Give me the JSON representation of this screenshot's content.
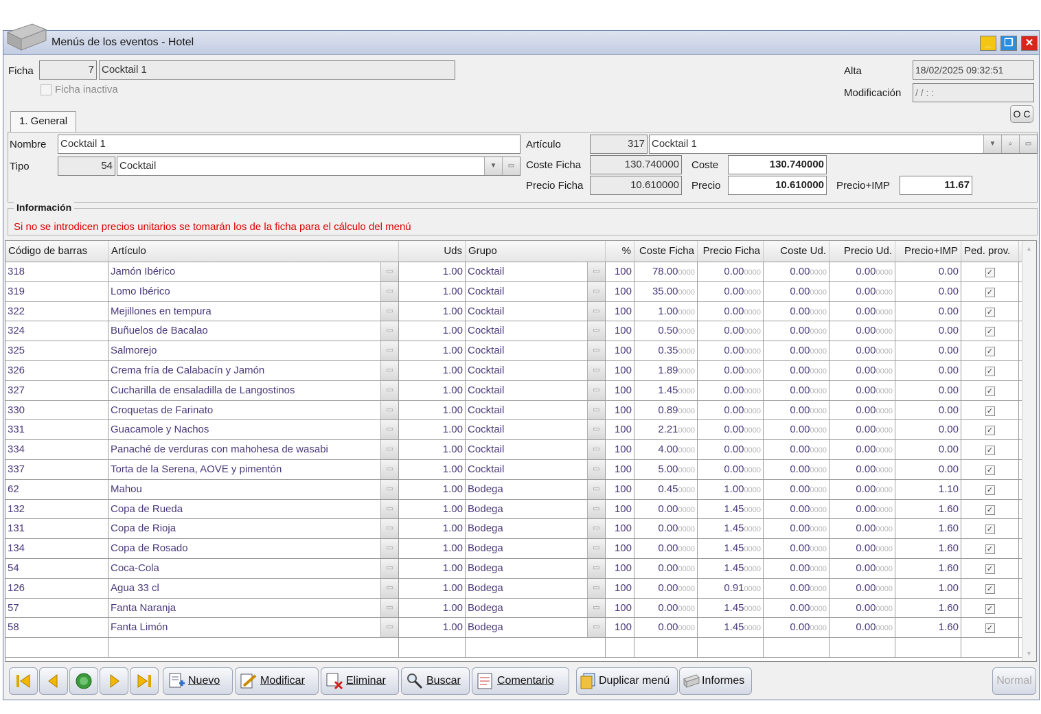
{
  "window": {
    "title": "Menús de los eventos - Hotel",
    "buttons": {
      "minimize": "_",
      "restore": "❐",
      "close": "✕"
    }
  },
  "header": {
    "ficha_label": "Ficha",
    "ficha_id": "7",
    "ficha_name": "Cocktail 1",
    "inactive_label": "Ficha inactiva",
    "inactive_checked": false,
    "alta_label": "Alta",
    "alta_value": "18/02/2025  09:32:51",
    "mod_label": "Modificación",
    "mod_value": " /  /           :   :",
    "oc_label": "O C"
  },
  "tabs": [
    {
      "label": "1. General"
    }
  ],
  "general": {
    "nombre_label": "Nombre",
    "nombre_value": "Cocktail 1",
    "tipo_label": "Tipo",
    "tipo_code": "54",
    "tipo_value": "Cocktail",
    "articulo_label": "Artículo",
    "articulo_code": "317",
    "articulo_value": "Cocktail 1",
    "coste_ficha_label": "Coste Ficha",
    "coste_ficha_value": "130.740000",
    "coste_label": "Coste",
    "coste_value": "130.740000",
    "precio_ficha_label": "Precio Ficha",
    "precio_ficha_value": "10.610000",
    "precio_label": "Precio",
    "precio_value": "10.610000",
    "precio_imp_label": "Precio+IMP",
    "precio_imp_value": "11.67"
  },
  "info": {
    "title": "Información",
    "message": "Si no se introdicen precios unitarios se tomarán los de la ficha para el cálculo del menú"
  },
  "table": {
    "columns": [
      "Código de barras",
      "Artículo",
      "Uds",
      "Grupo",
      "%",
      "Coste Ficha",
      "Precio Ficha",
      "Coste Ud.",
      "Precio Ud.",
      "Precio+IMP",
      "Ped. prov."
    ],
    "decimal_suffix": "0000",
    "rows": [
      {
        "code": "318",
        "articulo": "Jamón Ibérico",
        "uds": "1.00",
        "grupo": "Cocktail",
        "pct": "100",
        "coste_ficha": "78.00",
        "precio_ficha": "0.00",
        "coste_ud": "0.00",
        "precio_ud": "0.00",
        "precio_imp": "0.00",
        "ped_prov": true
      },
      {
        "code": "319",
        "articulo": "Lomo Ibérico",
        "uds": "1.00",
        "grupo": "Cocktail",
        "pct": "100",
        "coste_ficha": "35.00",
        "precio_ficha": "0.00",
        "coste_ud": "0.00",
        "precio_ud": "0.00",
        "precio_imp": "0.00",
        "ped_prov": true
      },
      {
        "code": "322",
        "articulo": "Mejillones en tempura",
        "uds": "1.00",
        "grupo": "Cocktail",
        "pct": "100",
        "coste_ficha": "1.00",
        "precio_ficha": "0.00",
        "coste_ud": "0.00",
        "precio_ud": "0.00",
        "precio_imp": "0.00",
        "ped_prov": true
      },
      {
        "code": "324",
        "articulo": "Buñuelos de Bacalao",
        "uds": "1.00",
        "grupo": "Cocktail",
        "pct": "100",
        "coste_ficha": "0.50",
        "precio_ficha": "0.00",
        "coste_ud": "0.00",
        "precio_ud": "0.00",
        "precio_imp": "0.00",
        "ped_prov": true
      },
      {
        "code": "325",
        "articulo": "Salmorejo",
        "uds": "1.00",
        "grupo": "Cocktail",
        "pct": "100",
        "coste_ficha": "0.35",
        "precio_ficha": "0.00",
        "coste_ud": "0.00",
        "precio_ud": "0.00",
        "precio_imp": "0.00",
        "ped_prov": true
      },
      {
        "code": "326",
        "articulo": "Crema fría de Calabacín y Jamón",
        "uds": "1.00",
        "grupo": "Cocktail",
        "pct": "100",
        "coste_ficha": "1.89",
        "precio_ficha": "0.00",
        "coste_ud": "0.00",
        "precio_ud": "0.00",
        "precio_imp": "0.00",
        "ped_prov": true
      },
      {
        "code": "327",
        "articulo": "Cucharilla de ensaladilla de Langostinos",
        "uds": "1.00",
        "grupo": "Cocktail",
        "pct": "100",
        "coste_ficha": "1.45",
        "precio_ficha": "0.00",
        "coste_ud": "0.00",
        "precio_ud": "0.00",
        "precio_imp": "0.00",
        "ped_prov": true
      },
      {
        "code": "330",
        "articulo": "Croquetas de Farinato",
        "uds": "1.00",
        "grupo": "Cocktail",
        "pct": "100",
        "coste_ficha": "0.89",
        "precio_ficha": "0.00",
        "coste_ud": "0.00",
        "precio_ud": "0.00",
        "precio_imp": "0.00",
        "ped_prov": true
      },
      {
        "code": "331",
        "articulo": "Guacamole y Nachos",
        "uds": "1.00",
        "grupo": "Cocktail",
        "pct": "100",
        "coste_ficha": "2.21",
        "precio_ficha": "0.00",
        "coste_ud": "0.00",
        "precio_ud": "0.00",
        "precio_imp": "0.00",
        "ped_prov": true
      },
      {
        "code": "334",
        "articulo": "Panaché de verduras con mahohesa de wasabi",
        "uds": "1.00",
        "grupo": "Cocktail",
        "pct": "100",
        "coste_ficha": "4.00",
        "precio_ficha": "0.00",
        "coste_ud": "0.00",
        "precio_ud": "0.00",
        "precio_imp": "0.00",
        "ped_prov": true
      },
      {
        "code": "337",
        "articulo": "Torta de la Serena, AOVE y pimentón",
        "uds": "1.00",
        "grupo": "Cocktail",
        "pct": "100",
        "coste_ficha": "5.00",
        "precio_ficha": "0.00",
        "coste_ud": "0.00",
        "precio_ud": "0.00",
        "precio_imp": "0.00",
        "ped_prov": true
      },
      {
        "code": "62",
        "articulo": "Mahou",
        "uds": "1.00",
        "grupo": "Bodega",
        "pct": "100",
        "coste_ficha": "0.45",
        "precio_ficha": "1.00",
        "coste_ud": "0.00",
        "precio_ud": "0.00",
        "precio_imp": "1.10",
        "ped_prov": true
      },
      {
        "code": "132",
        "articulo": "Copa de Rueda",
        "uds": "1.00",
        "grupo": "Bodega",
        "pct": "100",
        "coste_ficha": "0.00",
        "precio_ficha": "1.45",
        "coste_ud": "0.00",
        "precio_ud": "0.00",
        "precio_imp": "1.60",
        "ped_prov": true
      },
      {
        "code": "131",
        "articulo": "Copa de Rioja",
        "uds": "1.00",
        "grupo": "Bodega",
        "pct": "100",
        "coste_ficha": "0.00",
        "precio_ficha": "1.45",
        "coste_ud": "0.00",
        "precio_ud": "0.00",
        "precio_imp": "1.60",
        "ped_prov": true
      },
      {
        "code": "134",
        "articulo": "Copa de Rosado",
        "uds": "1.00",
        "grupo": "Bodega",
        "pct": "100",
        "coste_ficha": "0.00",
        "precio_ficha": "1.45",
        "coste_ud": "0.00",
        "precio_ud": "0.00",
        "precio_imp": "1.60",
        "ped_prov": true
      },
      {
        "code": "54",
        "articulo": "Coca-Cola",
        "uds": "1.00",
        "grupo": "Bodega",
        "pct": "100",
        "coste_ficha": "0.00",
        "precio_ficha": "1.45",
        "coste_ud": "0.00",
        "precio_ud": "0.00",
        "precio_imp": "1.60",
        "ped_prov": true
      },
      {
        "code": "126",
        "articulo": "Agua 33 cl",
        "uds": "1.00",
        "grupo": "Bodega",
        "pct": "100",
        "coste_ficha": "0.00",
        "precio_ficha": "0.91",
        "coste_ud": "0.00",
        "precio_ud": "0.00",
        "precio_imp": "1.00",
        "ped_prov": true
      },
      {
        "code": "57",
        "articulo": "Fanta Naranja",
        "uds": "1.00",
        "grupo": "Bodega",
        "pct": "100",
        "coste_ficha": "0.00",
        "precio_ficha": "1.45",
        "coste_ud": "0.00",
        "precio_ud": "0.00",
        "precio_imp": "1.60",
        "ped_prov": true
      },
      {
        "code": "58",
        "articulo": "Fanta Limón",
        "uds": "1.00",
        "grupo": "Bodega",
        "pct": "100",
        "coste_ficha": "0.00",
        "precio_ficha": "1.45",
        "coste_ud": "0.00",
        "precio_ud": "0.00",
        "precio_imp": "1.60",
        "ped_prov": true
      }
    ]
  },
  "toolbar": {
    "nav": [
      {
        "name": "first-record",
        "glyph": "⏮"
      },
      {
        "name": "previous-record",
        "glyph": "◀"
      },
      {
        "name": "refresh",
        "glyph": "●"
      },
      {
        "name": "next-record",
        "glyph": "▶"
      },
      {
        "name": "last-record",
        "glyph": "⏭"
      }
    ],
    "nuevo": "Nuevo",
    "modificar": "Modificar",
    "eliminar": "Eliminar",
    "buscar": "Buscar",
    "comentario": "Comentario",
    "duplicar": "Duplicar menú",
    "informes": "Informes",
    "normal": "Normal"
  },
  "colors": {
    "accent_text": "#4a3a7a",
    "warning_text": "#e00000",
    "close_button": "#d9261c",
    "minimize_button": "#f3c613",
    "restore_button": "#2a8fe0"
  },
  "icons": [
    "app-icon",
    "lookup-icon",
    "dropdown-arrow-icon",
    "checkbox-icon",
    "new-document-icon",
    "edit-icon",
    "delete-icon",
    "search-icon",
    "comment-icon",
    "duplicate-icon",
    "reports-icon"
  ]
}
